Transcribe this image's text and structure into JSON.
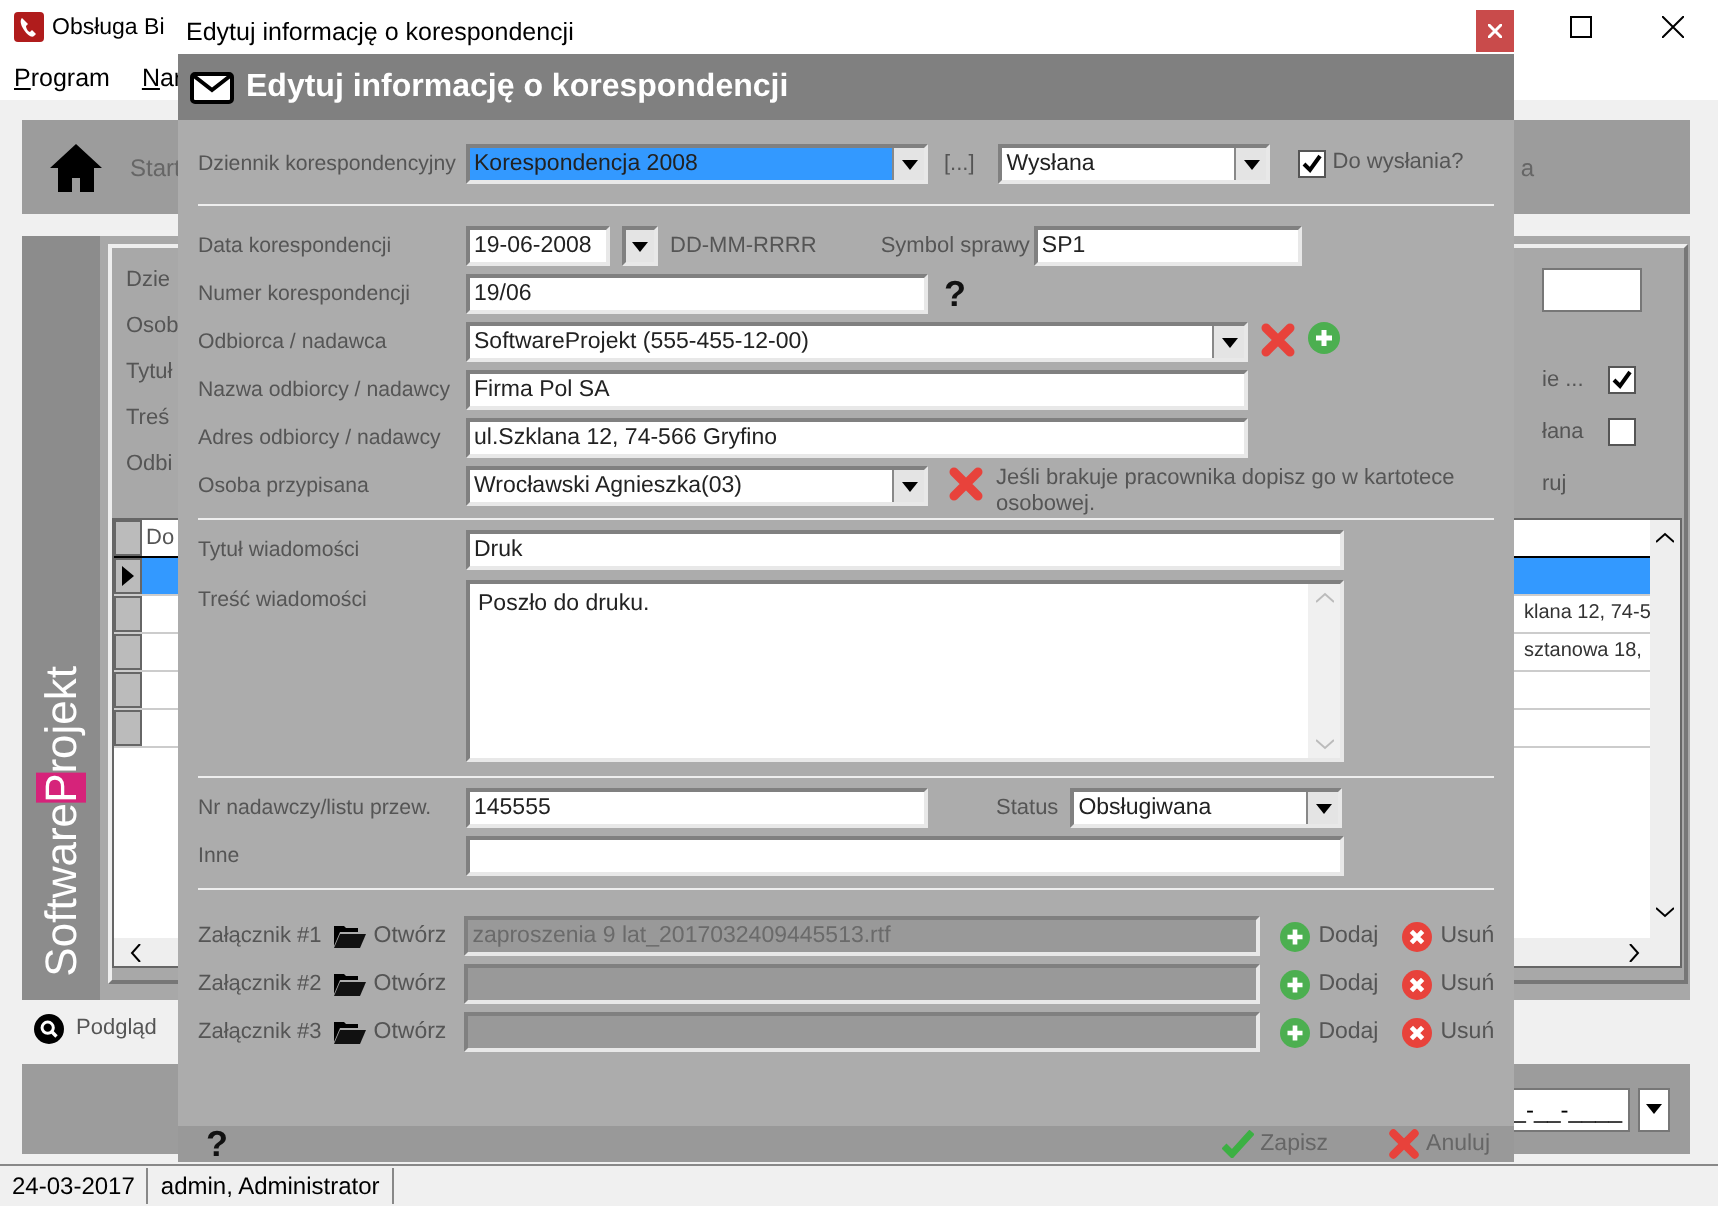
{
  "app": {
    "title": "Obsługa Bi",
    "menu": [
      {
        "label": "Program"
      },
      {
        "label": "Nar"
      }
    ],
    "toolbar": {
      "start": "Start",
      "right_fragment": "a"
    },
    "brand": {
      "prefix": "Software",
      "highlight": "P",
      "suffix": "rojekt"
    },
    "panel_labels": [
      "Dzie",
      "Osob",
      "Tytuł",
      "Treś",
      "Odbi"
    ],
    "right_options": [
      {
        "kind": "checkbox",
        "label": "ie ...",
        "checked": true
      },
      {
        "kind": "checkbox",
        "label": "łana",
        "checked": false
      },
      {
        "kind": "text",
        "label": "ruj"
      }
    ],
    "grid": {
      "header": "Do",
      "rows": [
        {
          "selected": true
        },
        {
          "selected": false,
          "cell": "klana 12, 74-5"
        },
        {
          "selected": false,
          "cell": "sztanowa 18,"
        },
        {
          "selected": false
        },
        {
          "selected": false
        }
      ]
    },
    "preview": "Podgląd",
    "date_mask": "_-__-____",
    "status_bar": [
      "24-03-2017",
      "admin, Administrator"
    ]
  },
  "dialog": {
    "title": "Edytuj informację o korespondencji",
    "heading": "Edytuj informację o korespondencji",
    "journal": {
      "label": "Dziennik korespondencyjny",
      "value": "Korespondencja 2008",
      "focused": true,
      "more": "[...]",
      "state": "Wysłana",
      "to_send": {
        "label": "Do wysłania?",
        "checked": true
      }
    },
    "date": {
      "label": "Data korespondencji",
      "value": "19-06-2008",
      "format": "DD-MM-RRRR",
      "case_label": "Symbol sprawy",
      "case_value": "SP1"
    },
    "number": {
      "label": "Numer korespondencji",
      "value": "19/06",
      "help": "?"
    },
    "recipient": {
      "label": "Odbiorca / nadawca",
      "value": "SoftwareProjekt (555-455-12-00)"
    },
    "recipient_name": {
      "label": "Nazwa odbiorcy / nadawcy",
      "value": "Firma Pol SA"
    },
    "recipient_address": {
      "label": "Adres odbiorcy / nadawcy",
      "value": "ul.Szklana 12, 74-566 Gryfino"
    },
    "assigned": {
      "label": "Osoba przypisana",
      "value": "Wrocławski Agnieszka(03)",
      "note": "Jeśli brakuje pracownika dopisz go w kartotece osobowej."
    },
    "subject": {
      "label": "Tytuł wiadomości",
      "value": "Druk"
    },
    "body": {
      "label": "Treść wiadomości",
      "value": "Poszło do druku."
    },
    "tracking": {
      "label": "Nr nadawczy/listu przew.",
      "value": "145555",
      "status_label": "Status",
      "status_value": "Obsługiwana"
    },
    "other": {
      "label": "Inne"
    },
    "attachments": [
      {
        "label": "Załącznik #1",
        "open": "Otwórz",
        "file": "zaproszenia 9 lat_2017032409445513.rtf",
        "add": "Dodaj",
        "remove": "Usuń"
      },
      {
        "label": "Załącznik #2",
        "open": "Otwórz",
        "add": "Dodaj",
        "remove": "Usuń"
      },
      {
        "label": "Załącznik #3",
        "open": "Otwórz",
        "add": "Dodaj",
        "remove": "Usuń"
      }
    ],
    "footer": {
      "help": "?",
      "save": "Zapisz",
      "cancel": "Anuluj"
    }
  }
}
